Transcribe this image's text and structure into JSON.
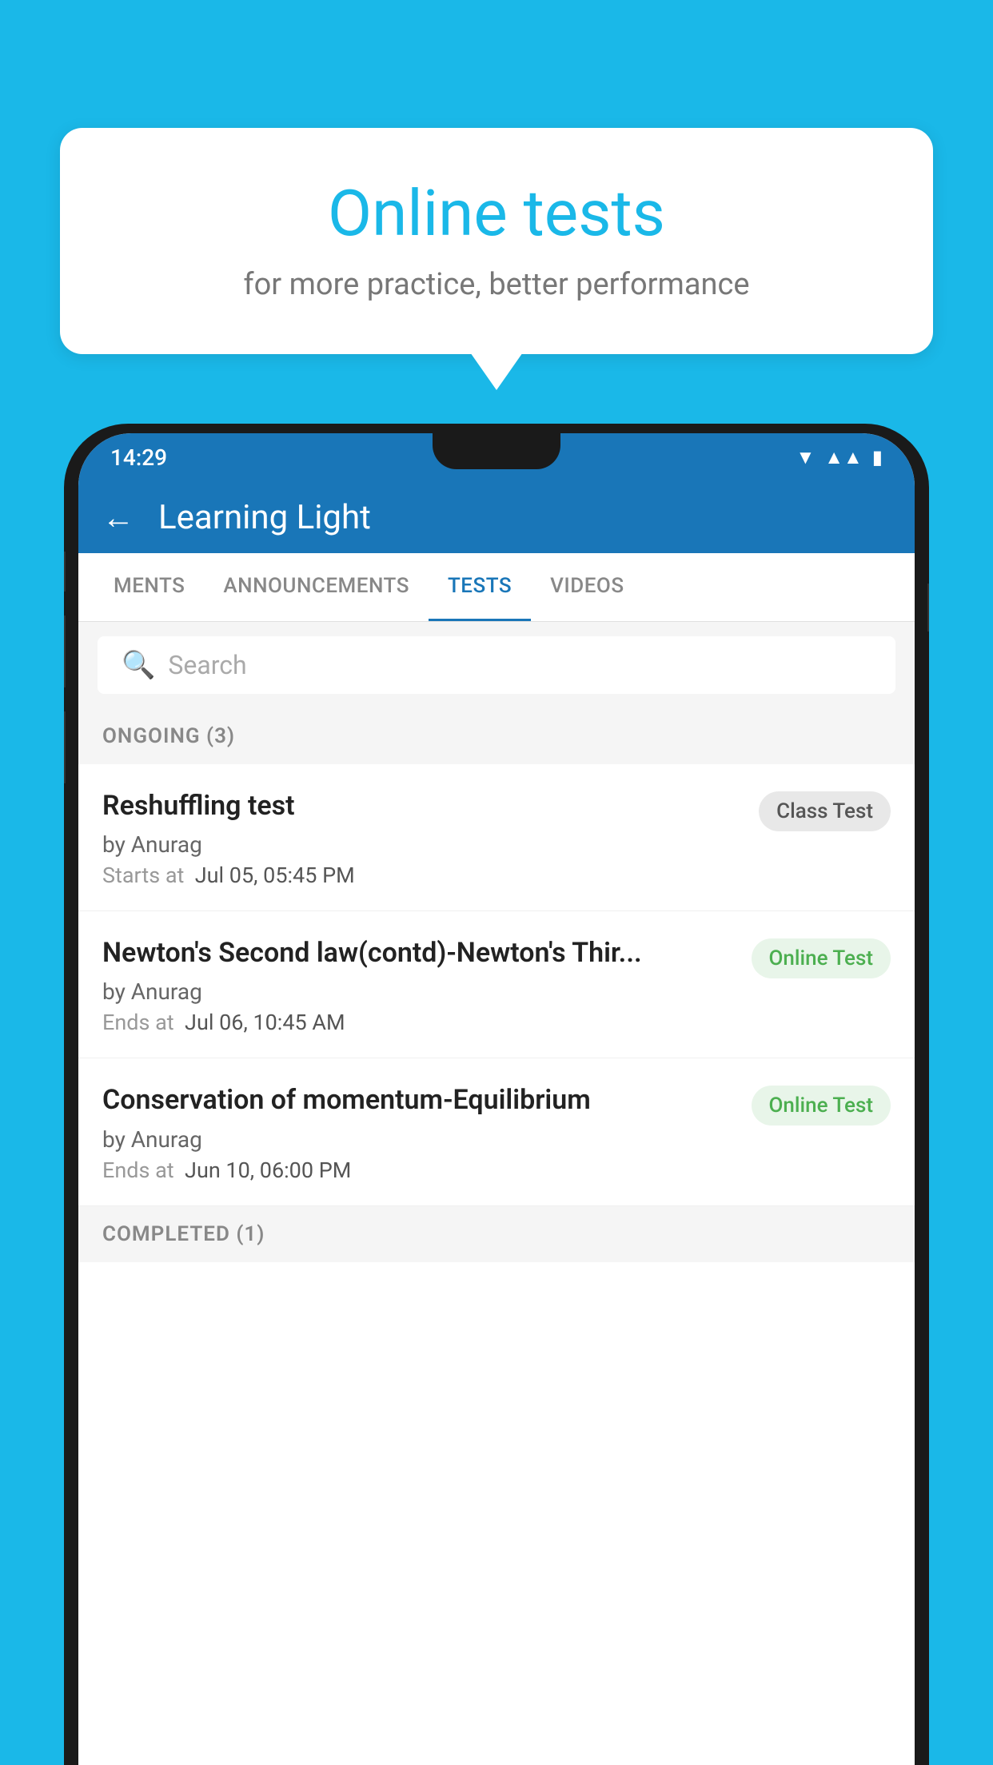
{
  "background_color": "#1ab8e8",
  "speech_bubble": {
    "title": "Online tests",
    "subtitle": "for more practice, better performance"
  },
  "status_bar": {
    "time": "14:29",
    "icons": [
      "wifi",
      "signal",
      "battery"
    ]
  },
  "app_bar": {
    "title": "Learning Light",
    "back_label": "←"
  },
  "tabs": [
    {
      "label": "MENTS",
      "active": false
    },
    {
      "label": "ANNOUNCEMENTS",
      "active": false
    },
    {
      "label": "TESTS",
      "active": true
    },
    {
      "label": "VIDEOS",
      "active": false
    }
  ],
  "search": {
    "placeholder": "Search"
  },
  "ongoing_section": {
    "label": "ONGOING (3)"
  },
  "tests": [
    {
      "name": "Reshuffling test",
      "by": "by Anurag",
      "time_label": "Starts at",
      "time_value": "Jul 05, 05:45 PM",
      "badge": "Class Test",
      "badge_type": "class"
    },
    {
      "name": "Newton's Second law(contd)-Newton's Thir...",
      "by": "by Anurag",
      "time_label": "Ends at",
      "time_value": "Jul 06, 10:45 AM",
      "badge": "Online Test",
      "badge_type": "online"
    },
    {
      "name": "Conservation of momentum-Equilibrium",
      "by": "by Anurag",
      "time_label": "Ends at",
      "time_value": "Jun 10, 06:00 PM",
      "badge": "Online Test",
      "badge_type": "online"
    }
  ],
  "completed_section": {
    "label": "COMPLETED (1)"
  }
}
